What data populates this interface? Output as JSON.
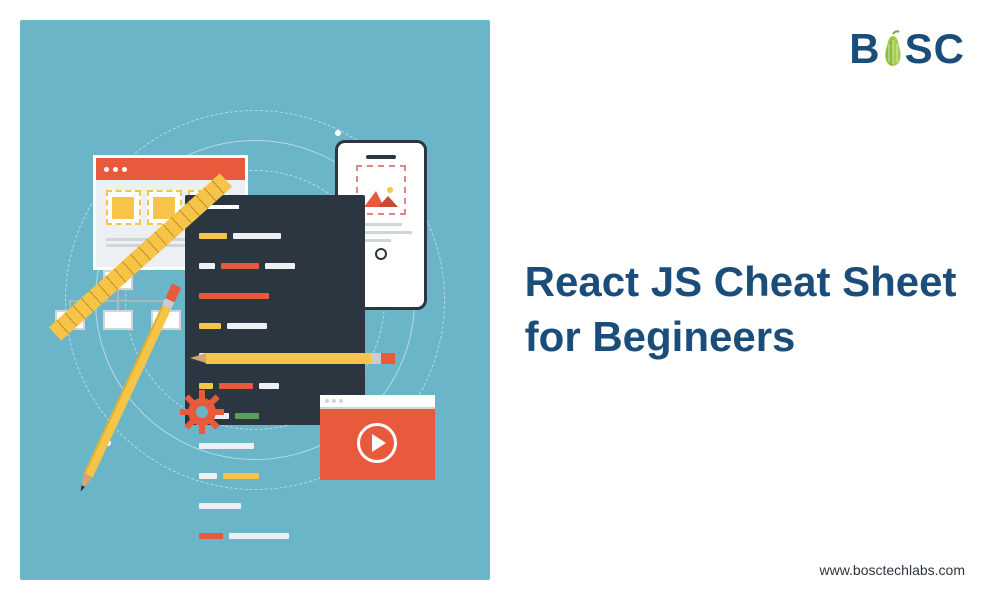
{
  "headline": "React JS Cheat Sheet for Begineers",
  "logo": {
    "letter_b": "B",
    "letter_s": "S",
    "letter_c": "C"
  },
  "footer": {
    "url": "www.bosctechlabs.com"
  },
  "colors": {
    "panel_bg": "#6bb5c9",
    "brand_navy": "#1a4d7a",
    "accent_orange": "#e85a3b",
    "accent_yellow": "#f6c449",
    "code_bg": "#2c3640"
  }
}
